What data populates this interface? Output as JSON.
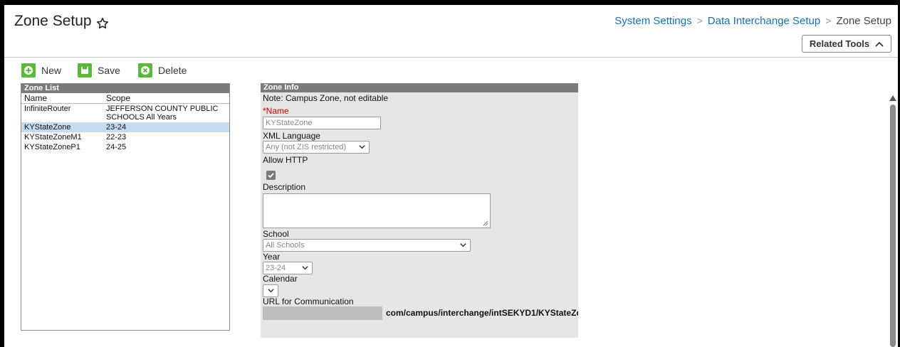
{
  "header": {
    "title": "Zone Setup",
    "breadcrumb": [
      "System Settings",
      "Data Interchange Setup",
      "Zone Setup"
    ],
    "related_tools": "Related Tools"
  },
  "toolbar": {
    "new_label": "New",
    "save_label": "Save",
    "delete_label": "Delete"
  },
  "zone_list": {
    "title": "Zone List",
    "columns": [
      "Name",
      "Scope"
    ],
    "rows": [
      {
        "name": "InfiniteRouter",
        "scope_line1": "JEFFERSON COUNTY PUBLIC",
        "scope_line2": "SCHOOLS All Years"
      },
      {
        "name": "KYStateZone",
        "scope_line1": "23-24",
        "selected": true
      },
      {
        "name": "KYStateZoneM1",
        "scope_line1": "22-23"
      },
      {
        "name": "KYStateZoneP1",
        "scope_line1": "24-25"
      }
    ]
  },
  "zone_info": {
    "title": "Zone Info",
    "note": "Note: Campus Zone, not editable",
    "name_label": "*Name",
    "name_value": "KYStateZone",
    "xml_language_label": "XML Language",
    "xml_language_value": "Any (not ZIS restricted)",
    "allow_http_label": "Allow HTTP",
    "allow_http_checked": true,
    "description_label": "Description",
    "school_label": "School",
    "school_value": "All Schools",
    "year_label": "Year",
    "year_value": "23-24",
    "calendar_label": "Calendar",
    "calendar_value": "",
    "url_label": "URL for Communication",
    "url_value": "com/campus/interchange/intSEKYD1/KYStateZo"
  },
  "colors": {
    "link": "#1a6fb5",
    "toolbar_icon": "#5cb83a",
    "selected_row": "#c6dbef",
    "panel_header": "#7b7b7b",
    "required": "#d00000"
  }
}
